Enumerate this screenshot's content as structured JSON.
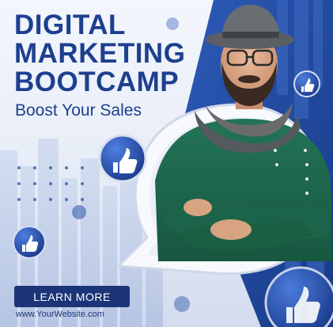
{
  "headline": {
    "line1": "DIGITAL",
    "line2": "MARKETING",
    "line3": "BOOTCAMP"
  },
  "tagline": "Boost Your Sales",
  "cta": {
    "label": "LEARN MORE"
  },
  "website": "www.YourWebsite.com",
  "icons": {
    "reaction": "thumbs-up-icon",
    "frame": "speech-bubble-icon"
  },
  "colors": {
    "brand_blue": "#1d3f8f",
    "button_navy": "#1b3578",
    "sweater_green": "#1f6b4e",
    "bubble_white": "#f7f9fc"
  }
}
